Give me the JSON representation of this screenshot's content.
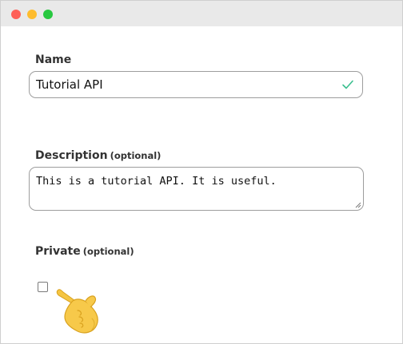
{
  "window": {
    "traffic_lights": [
      "close",
      "minimize",
      "zoom"
    ]
  },
  "form": {
    "name": {
      "label": "Name",
      "value": "Tutorial API",
      "valid": true,
      "status_icon": "checkmark-icon",
      "status_color": "#3bbf8f"
    },
    "description": {
      "label": "Description",
      "optional_label": "(optional)",
      "value": "This is a tutorial API. It is useful."
    },
    "private": {
      "label": "Private",
      "optional_label": "(optional)",
      "checked": false
    }
  },
  "cursor": {
    "icon": "pointing-hand-icon",
    "color": "#f5c542"
  }
}
